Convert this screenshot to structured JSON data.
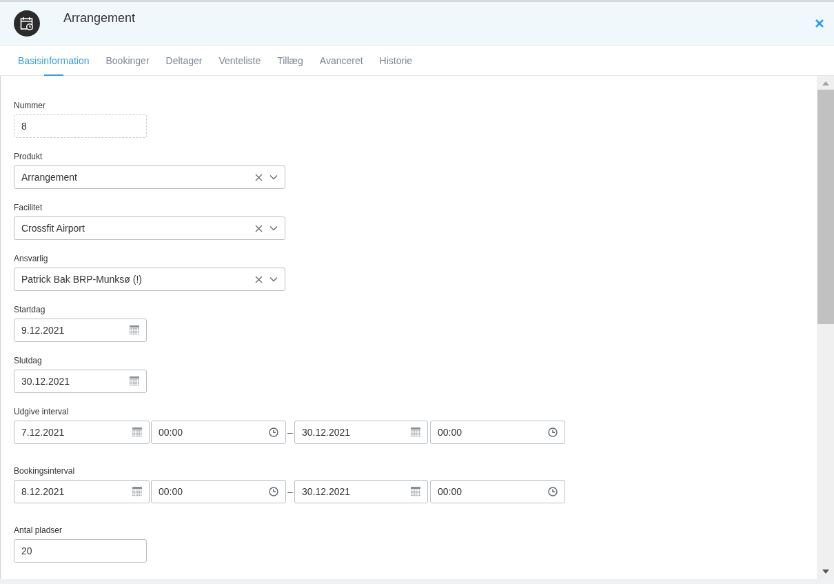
{
  "window": {
    "title": "Arrangement"
  },
  "tabs": [
    {
      "label": "Basisinformation",
      "selected": true
    },
    {
      "label": "Bookinger",
      "selected": false
    },
    {
      "label": "Deltager",
      "selected": false
    },
    {
      "label": "Venteliste",
      "selected": false
    },
    {
      "label": "Tillæg",
      "selected": false
    },
    {
      "label": "Avanceret",
      "selected": false
    },
    {
      "label": "Historie",
      "selected": false
    }
  ],
  "fields": [
    {
      "kind": "readonly",
      "label": "Nummer",
      "value": "8"
    },
    {
      "kind": "select",
      "label": "Produkt",
      "value": "Arrangement"
    },
    {
      "kind": "select",
      "label": "Facilitet",
      "value": "Crossfit Airport"
    },
    {
      "kind": "select",
      "label": "Ansvarlig",
      "value": "Patrick Bak BRP-Munksø (!)"
    },
    {
      "kind": "date",
      "label": "Startdag",
      "value": "9.12.2021"
    },
    {
      "kind": "date",
      "label": "Slutdag",
      "value": "30.12.2021"
    },
    {
      "kind": "interval",
      "label": "Udgive interval",
      "start_date": "7.12.2021",
      "start_time": "00:00",
      "separator": "–",
      "end_date": "30.12.2021",
      "end_time": "00:00"
    },
    {
      "kind": "interval",
      "label": "Bookingsinterval",
      "start_date": "8.12.2021",
      "start_time": "00:00",
      "separator": "–",
      "end_date": "30.12.2021",
      "end_time": "00:00"
    },
    {
      "kind": "number",
      "label": "Antal pladser",
      "value": "20"
    }
  ]
}
